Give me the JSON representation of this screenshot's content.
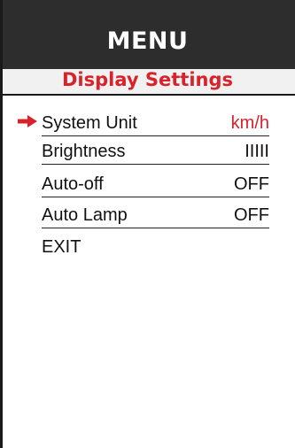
{
  "header": {
    "title": "MENU"
  },
  "section": {
    "title": "Display Settings"
  },
  "items": [
    {
      "label": "System Unit",
      "value": "km/h",
      "selected": true
    },
    {
      "label": "Brightness",
      "value": "IIIII",
      "selected": false
    },
    {
      "label": "Auto-off",
      "value": "OFF",
      "selected": false
    },
    {
      "label": "Auto Lamp",
      "value": "OFF",
      "selected": false
    },
    {
      "label": "EXIT",
      "value": "",
      "selected": false
    }
  ],
  "colors": {
    "header_bg": "#2d2d2d",
    "accent": "#d8222c",
    "subheader_bg": "#f1f1f1"
  },
  "icons": {
    "selection_pointer": "arrow-right-icon"
  }
}
